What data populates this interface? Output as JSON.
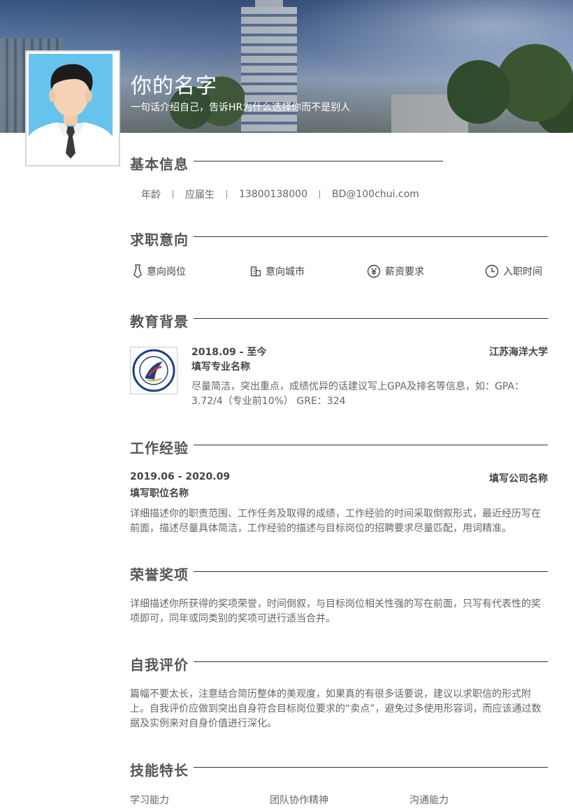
{
  "header": {
    "name": "你的名字",
    "tagline": "一句话介绍自己，告诉HR为什么选择你而不是别人"
  },
  "sections": {
    "basic_info": "基本信息",
    "job_intent": "求职意向",
    "education": "教育背景",
    "work": "工作经验",
    "honors": "荣誉奖项",
    "self_eval": "自我评价",
    "skills": "技能特长"
  },
  "basic_info": {
    "age": "年龄",
    "status": "应届生",
    "phone": "13800138000",
    "email": "BD@100chui.com"
  },
  "job_intent": {
    "position": "意向岗位",
    "city": "意向城市",
    "salary": "薪资要求",
    "start": "入职时间"
  },
  "education": {
    "date": "2018.09 - 至今",
    "school": "江苏海洋大学",
    "major": "填写专业名称",
    "desc": "尽量简洁，突出重点，成绩优异的话建议写上GPA及排名等信息，如：GPA：3.72/4（专业前10%） GRE：324"
  },
  "work": {
    "date": "2019.06 - 2020.09",
    "company": "填写公司名称",
    "title": "填写职位名称",
    "desc": "详细描述你的职责范围、工作任务及取得的成绩，工作经验的时间采取倒叙形式，最近经历写在前面，描述尽量具体简洁，工作经验的描述与目标岗位的招聘要求尽量匹配，用词精准。"
  },
  "honors": {
    "desc": "详细描述你所获得的奖项荣誉，时间倒叙，与目标岗位相关性强的写在前面，只写有代表性的奖项即可，同年或同类别的奖项可进行适当合并。"
  },
  "self_eval": {
    "desc": "篇幅不要太长，注意结合简历整体的美观度，如果真的有很多话要说，建议以求职信的形式附上。自我评价应做到突出自身符合目标岗位要求的“卖点”，避免过多使用形容词，而应该通过数据及实例来对自身价值进行深化。"
  },
  "skills": [
    "学习能力",
    "团队协作精神",
    "沟通能力"
  ],
  "colors": {
    "heading": "#555555",
    "rule": "#333333",
    "avatar_bg": "#66c3ee"
  },
  "icons": {
    "position": "tie-icon",
    "city": "building-icon",
    "salary": "yuan-icon",
    "start": "clock-icon"
  }
}
